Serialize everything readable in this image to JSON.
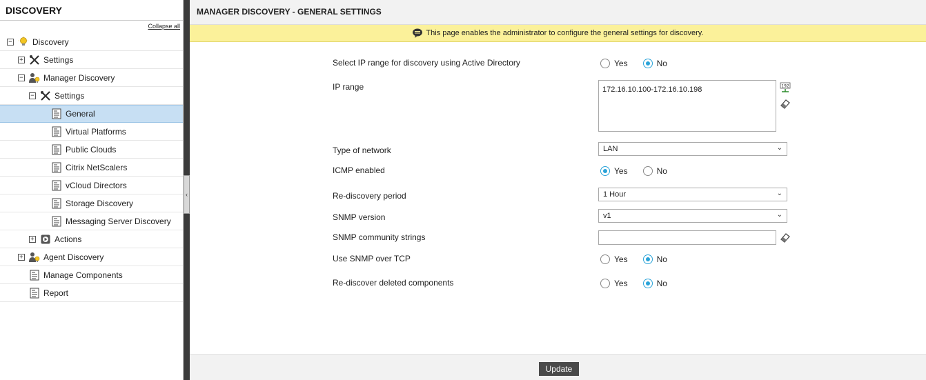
{
  "sidebar": {
    "title": "DISCOVERY",
    "collapse_all": "Collapse all",
    "items": [
      {
        "label": "Discovery",
        "toggle": "−",
        "indent": 0,
        "icon": "bulb-icon"
      },
      {
        "label": "Settings",
        "toggle": "+",
        "indent": 1,
        "icon": "tools-icon"
      },
      {
        "label": "Manager Discovery",
        "toggle": "−",
        "indent": 1,
        "icon": "manager-icon"
      },
      {
        "label": "Settings",
        "toggle": "−",
        "indent": 2,
        "icon": "tools-icon"
      },
      {
        "label": "General",
        "toggle": "",
        "indent": 3,
        "icon": "page-icon"
      },
      {
        "label": "Virtual Platforms",
        "toggle": "",
        "indent": 3,
        "icon": "page-icon"
      },
      {
        "label": "Public Clouds",
        "toggle": "",
        "indent": 3,
        "icon": "page-icon"
      },
      {
        "label": "Citrix NetScalers",
        "toggle": "",
        "indent": 3,
        "icon": "page-icon"
      },
      {
        "label": "vCloud Directors",
        "toggle": "",
        "indent": 3,
        "icon": "page-icon"
      },
      {
        "label": "Storage Discovery",
        "toggle": "",
        "indent": 3,
        "icon": "page-icon"
      },
      {
        "label": "Messaging Server Discovery",
        "toggle": "",
        "indent": 3,
        "icon": "page-icon"
      },
      {
        "label": "Actions",
        "toggle": "+",
        "indent": 2,
        "icon": "actions-icon"
      },
      {
        "label": "Agent Discovery",
        "toggle": "+",
        "indent": 1,
        "icon": "agent-icon"
      },
      {
        "label": "Manage Components",
        "toggle": "",
        "indent": 1,
        "icon": "page-icon"
      },
      {
        "label": "Report",
        "toggle": "",
        "indent": 1,
        "icon": "page-icon"
      }
    ]
  },
  "main": {
    "title": "MANAGER DISCOVERY - GENERAL SETTINGS",
    "info": "This page enables the administrator to configure the general settings for discovery."
  },
  "form": {
    "ad_range_label": "Select IP range for discovery using Active Directory",
    "ip_range_label": "IP range",
    "ip_range_value": "172.16.10.100-172.16.10.198",
    "network_type_label": "Type of network",
    "network_type_value": "LAN",
    "icmp_label": "ICMP enabled",
    "rediscovery_label": "Re-discovery period",
    "rediscovery_value": "1 Hour",
    "snmp_version_label": "SNMP version",
    "snmp_version_value": "v1",
    "snmp_community_label": "SNMP community strings",
    "snmp_tcp_label": "Use SNMP over TCP",
    "rediscover_deleted_label": "Re-discover deleted components",
    "yes": "Yes",
    "no": "No"
  },
  "footer": {
    "update_label": "Update"
  },
  "colors": {
    "accent": "#2aa3d8",
    "info_bg": "#fbf19a",
    "selected_bg": "#c7dff3"
  }
}
